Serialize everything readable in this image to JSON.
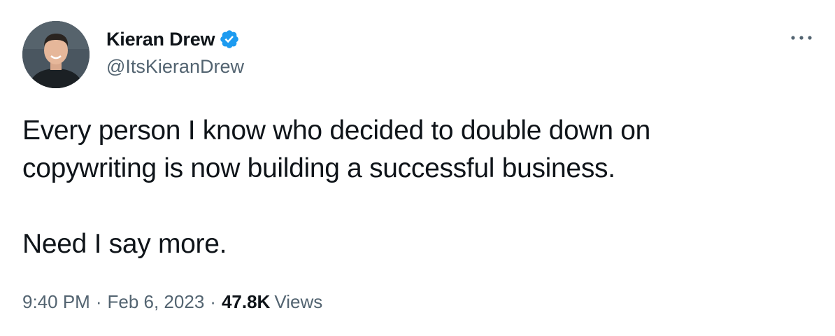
{
  "author": {
    "display_name": "Kieran Drew",
    "handle": "@ItsKieranDrew",
    "verified": true
  },
  "tweet": {
    "lines": [
      "Every person I know who decided to double down on",
      "copywriting is now building a successful business.",
      "Need I say more."
    ],
    "time": "9:40 PM",
    "separator": "·",
    "date": "Feb 6, 2023",
    "views_count": "47.8K",
    "views_label": "Views"
  },
  "icons": {
    "verified": "verified-badge-icon",
    "more": "more-options-icon"
  },
  "colors": {
    "primary_text": "#0f1419",
    "secondary_text": "#536471",
    "verified_blue": "#1d9bf0"
  }
}
